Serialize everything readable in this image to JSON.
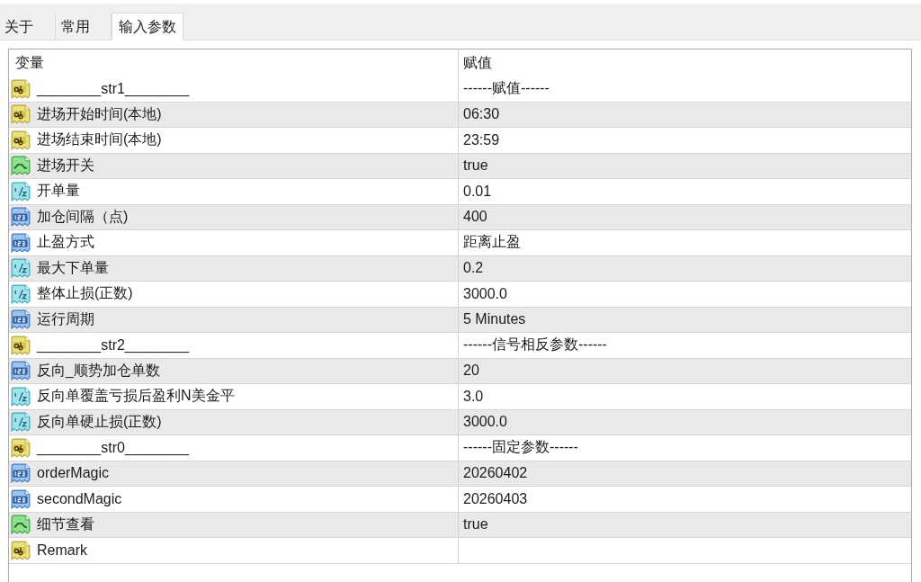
{
  "tabs": [
    {
      "label": "关于",
      "selected": false
    },
    {
      "label": "常用",
      "selected": false
    },
    {
      "label": "输入参数",
      "selected": true
    }
  ],
  "table": {
    "columns": [
      "变量",
      "赋值"
    ],
    "rows": [
      {
        "kind": "string",
        "name": "________str1________",
        "value": "------赋值------"
      },
      {
        "kind": "string",
        "name": "进场开始时间(本地)",
        "value": "06:30"
      },
      {
        "kind": "string",
        "name": "进场结束时间(本地)",
        "value": "23:59"
      },
      {
        "kind": "bool",
        "name": "进场开关",
        "value": "true"
      },
      {
        "kind": "double",
        "name": "开单量",
        "value": "0.01"
      },
      {
        "kind": "int",
        "name": "加仓间隔（点)",
        "value": "400"
      },
      {
        "kind": "int",
        "name": "止盈方式",
        "value": "距离止盈"
      },
      {
        "kind": "double",
        "name": "最大下单量",
        "value": "0.2"
      },
      {
        "kind": "double",
        "name": "整体止损(正数)",
        "value": "3000.0"
      },
      {
        "kind": "int",
        "name": "运行周期",
        "value": "5 Minutes"
      },
      {
        "kind": "string",
        "name": "________str2________",
        "value": "------信号相反参数------"
      },
      {
        "kind": "int",
        "name": "反向_顺势加仓单数",
        "value": "20"
      },
      {
        "kind": "double",
        "name": "反向单覆盖亏损后盈利N美金平",
        "value": "3.0"
      },
      {
        "kind": "double",
        "name": "反向单硬止损(正数)",
        "value": "3000.0"
      },
      {
        "kind": "string",
        "name": "________str0________",
        "value": "------固定参数------"
      },
      {
        "kind": "int",
        "name": "orderMagic",
        "value": "20260402"
      },
      {
        "kind": "int",
        "name": "secondMagic",
        "value": "20260403"
      },
      {
        "kind": "bool",
        "name": "细节查看",
        "value": "true"
      },
      {
        "kind": "string",
        "name": "Remark"
      }
    ]
  }
}
